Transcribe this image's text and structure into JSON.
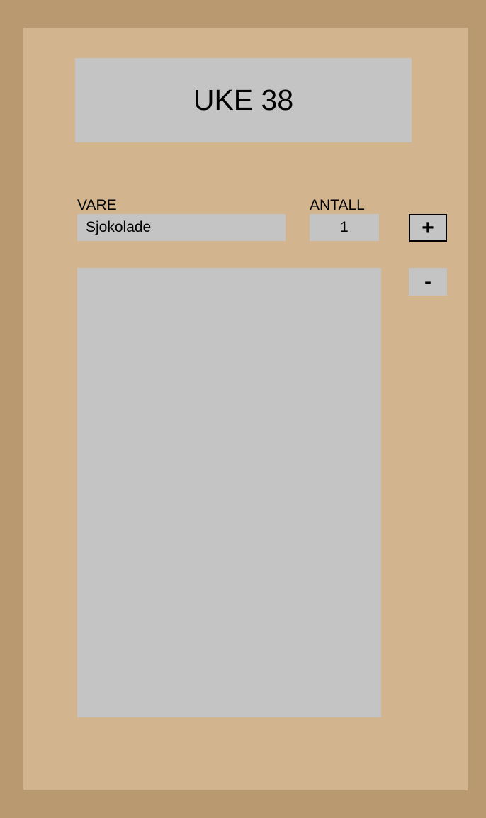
{
  "header": {
    "week_title": "UKE 38"
  },
  "form": {
    "item_label": "VARE",
    "item_value": "Sjokolade",
    "quantity_label": "ANTALL",
    "quantity_value": "1"
  },
  "actions": {
    "add_label": "+",
    "remove_label": "-"
  },
  "list": {
    "items": []
  },
  "colors": {
    "outer_background": "#b9996f",
    "panel_background": "#d2b48e",
    "field_background": "#c4c4c4",
    "text": "#000000"
  }
}
